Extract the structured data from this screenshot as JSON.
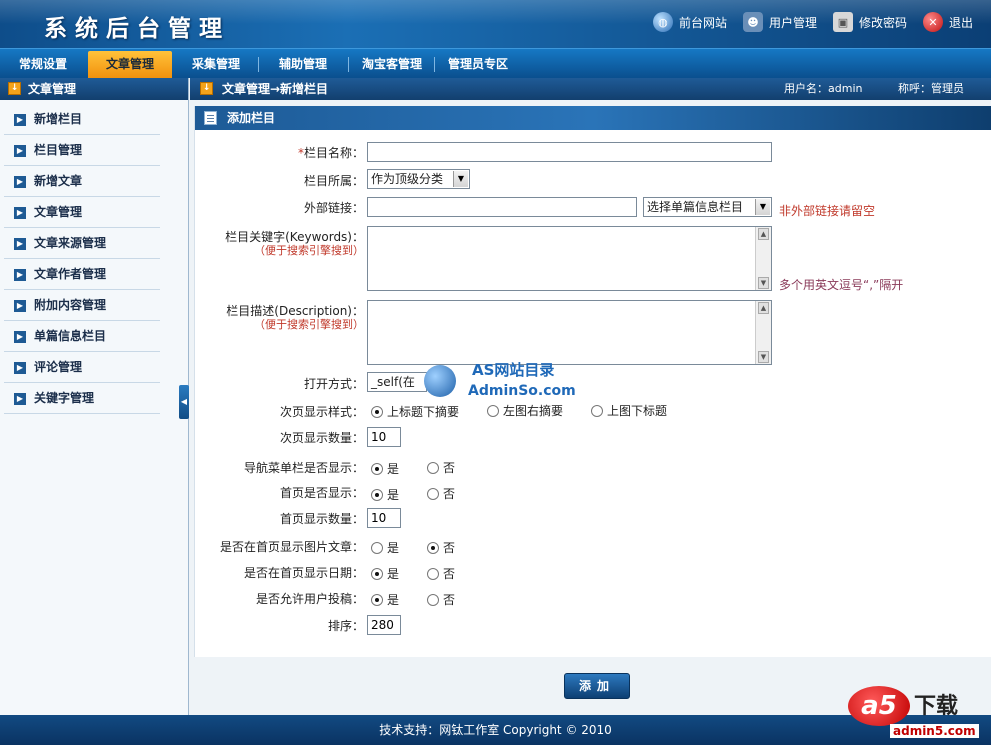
{
  "header": {
    "title": "系统后台管理",
    "links": [
      {
        "label": "前台网站",
        "icon": "globe-icon"
      },
      {
        "label": "用户管理",
        "icon": "user-icon"
      },
      {
        "label": "修改密码",
        "icon": "lock-icon"
      },
      {
        "label": "退出",
        "icon": "close-icon"
      }
    ]
  },
  "nav": {
    "items": [
      {
        "label": "常规设置"
      },
      {
        "label": "文章管理",
        "active": true
      },
      {
        "label": "采集管理"
      },
      {
        "label": "辅助管理"
      },
      {
        "label": "淘宝客管理"
      },
      {
        "label": "管理员专区"
      }
    ]
  },
  "sidebar": {
    "title": "文章管理",
    "items": [
      {
        "label": "新增栏目"
      },
      {
        "label": "栏目管理"
      },
      {
        "label": "新增文章"
      },
      {
        "label": "文章管理"
      },
      {
        "label": "文章来源管理"
      },
      {
        "label": "文章作者管理"
      },
      {
        "label": "附加内容管理"
      },
      {
        "label": "单篇信息栏目"
      },
      {
        "label": "评论管理"
      },
      {
        "label": "关键字管理"
      }
    ]
  },
  "crumb": {
    "path": "文章管理→新增栏目",
    "user": "用户名：admin",
    "role": "称呼：管理员"
  },
  "panel": {
    "title": "添加栏目"
  },
  "form": {
    "name_label": "栏目名称：",
    "name_required": "*",
    "parent_label": "栏目所属：",
    "parent_value": "作为顶级分类",
    "link_label": "外部链接：",
    "link_select": "选择单篇信息栏目",
    "link_hint": "非外部链接请留空",
    "keywords_label": "栏目关键字(Keywords)：",
    "keywords_sub": "（便于搜索引擎搜到）",
    "keywords_hint": "多个用英文逗号“,”隔开",
    "desc_label": "栏目描述(Description)：",
    "desc_sub": "（便于搜索引擎搜到）",
    "open_label": "打开方式：",
    "open_value": "_self(在",
    "style_label": "次页显示样式：",
    "style_options": [
      "上标题下摘要",
      "左图右摘要",
      "上图下标题"
    ],
    "count_label": "次页显示数量：",
    "count_value": "10",
    "navshow_label": "导航菜单栏是否显示：",
    "homeshow_label": "首页是否显示：",
    "homecount_label": "首页显示数量：",
    "homecount_value": "10",
    "homeimg_label": "是否在首页显示图片文章：",
    "homedate_label": "是否在首页显示日期：",
    "allowpost_label": "是否允许用户投稿：",
    "sort_label": "排序：",
    "sort_value": "280",
    "yes": "是",
    "no": "否",
    "submit": "添加"
  },
  "watermark": {
    "title": "AS网站目录",
    "url": "AdminSo.com"
  },
  "footer": {
    "text": "技术支持：网钛工作室  Copyright © 2010"
  },
  "corner_logo": {
    "mark": "a5",
    "text": "下载",
    "url": "admin5.com"
  }
}
